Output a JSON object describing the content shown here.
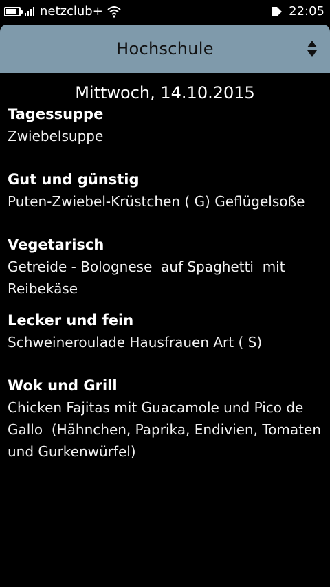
{
  "status_bar": {
    "carrier": "netzclub+",
    "time": "22:05",
    "battery_level": 0.8,
    "signal_bars": 4
  },
  "header": {
    "title": "Hochschule"
  },
  "menu": {
    "date": "Mittwoch, 14.10.2015",
    "sections": [
      {
        "category": "Tagessuppe",
        "dish": "Zwiebelsuppe"
      },
      {
        "category": "Gut und günstig",
        "dish": "Puten-Zwiebel-Krüstchen ( G) Geflügelsoße"
      },
      {
        "category": "Vegetarisch",
        "dish": "Getreide - Bolognese  auf Spaghetti  mit Reibekäse"
      },
      {
        "category": "Lecker und fein",
        "dish": "Schweineroulade Hausfrauen Art ( S)"
      },
      {
        "category": "Wok und Grill",
        "dish": "Chicken Fajitas mit Guacamole und Pico de Gallo  (Hähnchen, Paprika, Endivien, Tomaten und Gurkenwürfel)"
      }
    ]
  },
  "colors": {
    "header_bg": "#7f9aab",
    "background": "#000000",
    "text": "#ffffff"
  }
}
